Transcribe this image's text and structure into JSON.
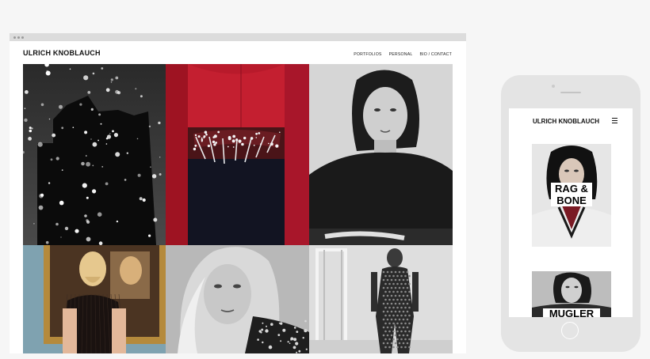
{
  "site": {
    "title": "ULRICH KNOBLAUCH",
    "nav": [
      "PORTFOLIOS",
      "PERSONAL",
      "BIO / CONTACT"
    ]
  },
  "gallery": [
    {
      "name": "photo-building-snow"
    },
    {
      "name": "photo-red-jacket-belt"
    },
    {
      "name": "photo-portrait-black-sweater"
    },
    {
      "name": "photo-woman-in-front-of-painting"
    },
    {
      "name": "photo-portrait-blonde-woman"
    },
    {
      "name": "photo-model-sequin-back"
    }
  ],
  "mobile": {
    "title": "ULRICH KNOBLAUCH",
    "cards": [
      {
        "label_line1": "RAG &",
        "label_line2": "BONE"
      },
      {
        "label_line1": "MUGLER",
        "label_line2": ""
      }
    ]
  },
  "colors": {
    "background": "#f6f6f6",
    "browser_bar": "#dcdcdc",
    "phone_body": "#e4e4e4",
    "accent_red": "#c0182c"
  }
}
